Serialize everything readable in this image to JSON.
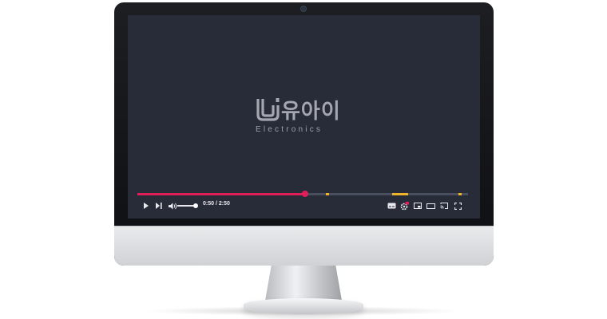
{
  "player": {
    "brand_korean": "유아이",
    "brand_sub": "Electronics",
    "time_display": "0:50 / 2:50",
    "progress_fraction": 0.507,
    "chapter_markers": [
      0.57,
      0.77,
      0.78,
      0.79,
      0.8,
      0.81,
      0.97
    ],
    "colors": {
      "screen_bg": "#282b38",
      "progress_played": "#e01e5a",
      "progress_track": "#4a4f5f",
      "marker": "#f0b429",
      "settings_badge": "#e01e5a"
    },
    "controls_left": [
      "play-icon",
      "next-icon",
      "volume-icon"
    ],
    "controls_right": [
      "subtitles-icon",
      "settings-icon",
      "miniplayer-icon",
      "theater-icon",
      "cast-icon",
      "fullscreen-icon"
    ]
  }
}
